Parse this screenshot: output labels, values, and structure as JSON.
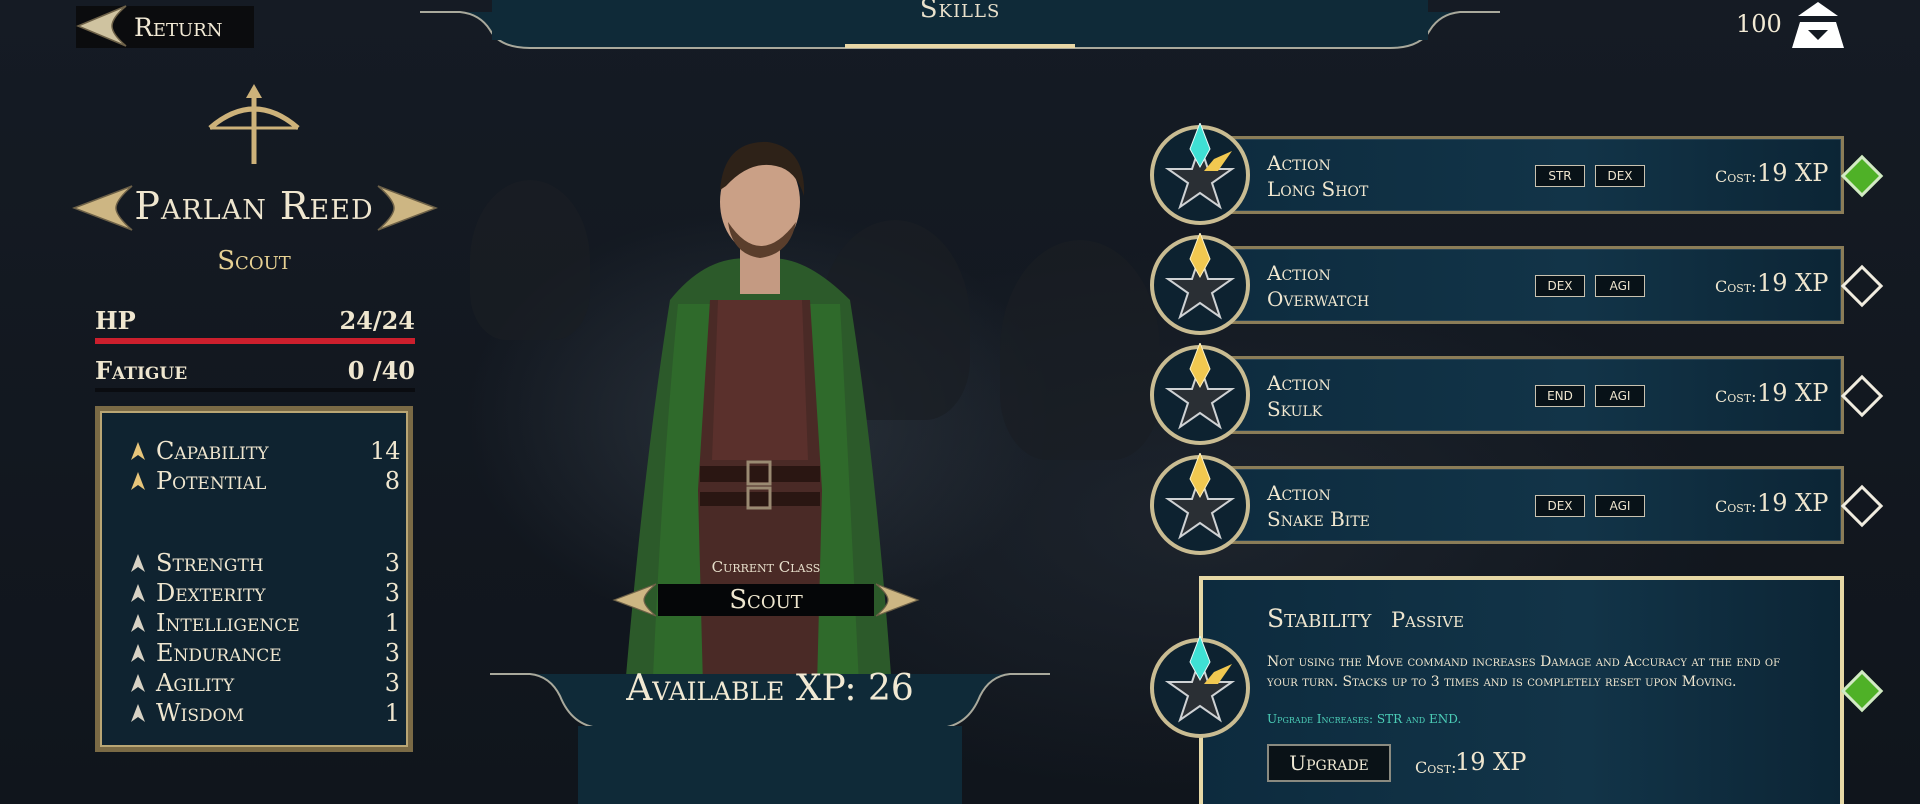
{
  "header": {
    "title": "Skills",
    "return_label": "Return",
    "currency": "100"
  },
  "character": {
    "name": "Parlan Reed",
    "class": "Scout"
  },
  "vitals": {
    "hp": {
      "label": "HP",
      "value": "24/24"
    },
    "fatigue": {
      "label": "Fatigue",
      "value": "0 /40"
    }
  },
  "attributes": [
    {
      "label": "Capability",
      "value": "14"
    },
    {
      "label": "Potential",
      "value": "8"
    },
    {
      "label": "Strength",
      "value": "3"
    },
    {
      "label": "Dexterity",
      "value": "3"
    },
    {
      "label": "Intelligence",
      "value": "1"
    },
    {
      "label": "Endurance",
      "value": "3"
    },
    {
      "label": "Agility",
      "value": "3"
    },
    {
      "label": "Wisdom",
      "value": "1"
    }
  ],
  "class_selector": {
    "caption": "Current Class",
    "value": "Scout"
  },
  "xp": {
    "label": "Available XP: 26"
  },
  "cost_label": "Cost:",
  "skills": [
    {
      "type": "Action",
      "name": "Long Shot",
      "tags": [
        "STR",
        "DEX"
      ],
      "cost": "19 XP",
      "active": true
    },
    {
      "type": "Action",
      "name": "Overwatch",
      "tags": [
        "DEX",
        "AGI"
      ],
      "cost": "19 XP",
      "active": false
    },
    {
      "type": "Action",
      "name": "Skulk",
      "tags": [
        "END",
        "AGI"
      ],
      "cost": "19 XP",
      "active": false
    },
    {
      "type": "Action",
      "name": "Snake Bite",
      "tags": [
        "DEX",
        "AGI"
      ],
      "cost": "19 XP",
      "active": false
    }
  ],
  "selected_skill": {
    "name": "Stability",
    "type": "Passive",
    "description": "Not using the Move command increases Damage and Accuracy at the end of your turn. Stacks up to 3 times and is completely reset upon Moving.",
    "upgrade_note": "Upgrade Increases: STR and END.",
    "upgrade_label": "Upgrade",
    "cost": "19 XP"
  },
  "colors": {
    "hp": "#cc1f2d",
    "gold": "#e7d193",
    "active": "#4fb127",
    "teal_gem": "#3fe0d4",
    "gold_gem": "#f1c850"
  }
}
